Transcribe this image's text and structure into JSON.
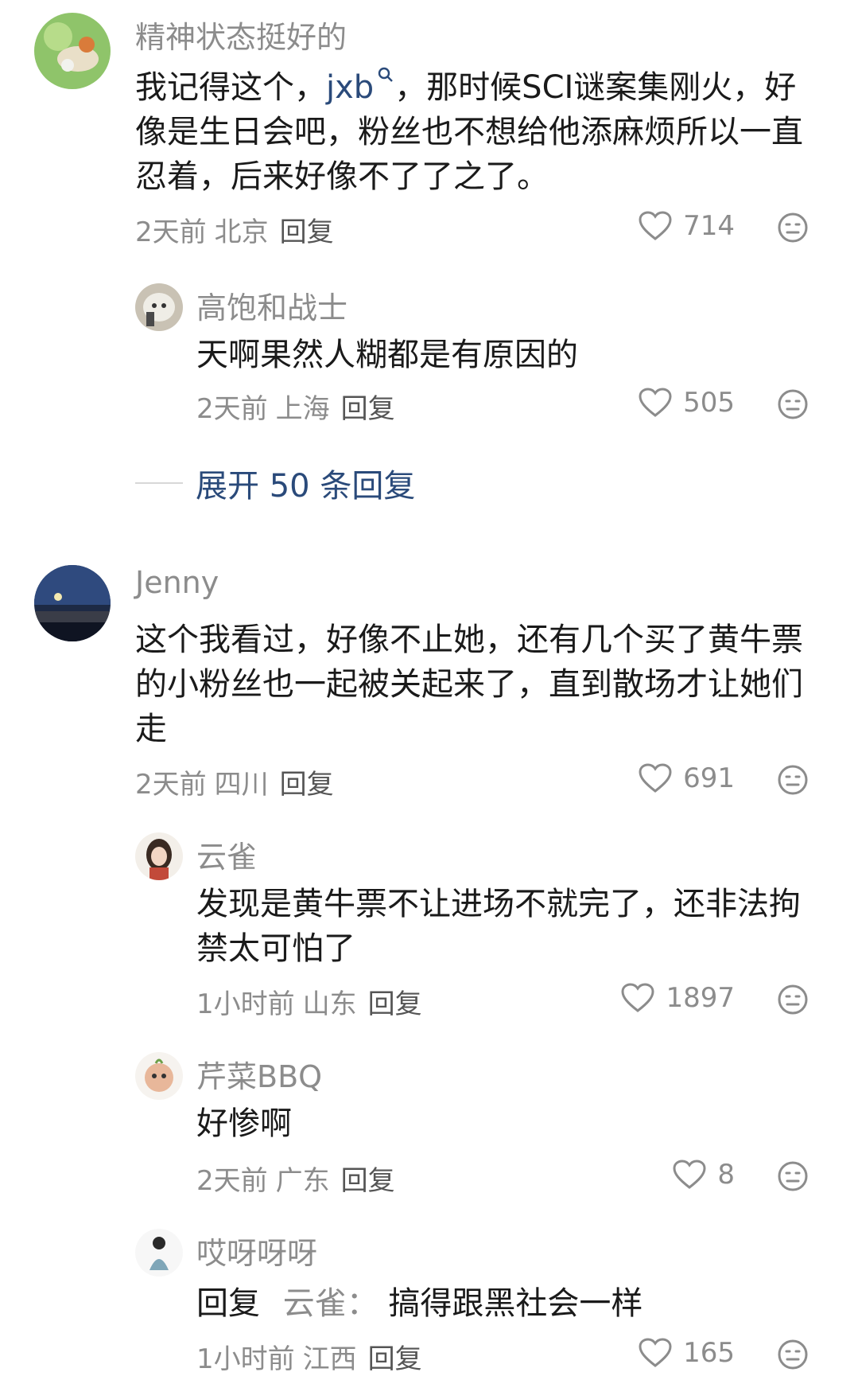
{
  "comments": [
    {
      "username": "精神状态挺好的",
      "text_before": "我记得这个，",
      "mention": "jxb",
      "text_after": "，那时候SCI谜案集刚火，好像是生日会吧，粉丝也不想给他添麻烦所以一直忍着，后来好像不了了之了。",
      "time": "2天前",
      "location": "北京",
      "reply_label": "回复",
      "likes": "714",
      "replies": [
        {
          "username": "高饱和战士",
          "text": "天啊果然人糊都是有原因的",
          "time": "2天前",
          "location": "上海",
          "reply_label": "回复",
          "likes": "505"
        }
      ],
      "expand_label": "展开 50 条回复"
    },
    {
      "username": "Jenny",
      "text": "这个我看过，好像不止她，还有几个买了黄牛票的小粉丝也一起被关起来了，直到散场才让她们走",
      "time": "2天前",
      "location": "四川",
      "reply_label": "回复",
      "likes": "691",
      "replies": [
        {
          "username": "云雀",
          "text": "发现是黄牛票不让进场不就完了，还非法拘禁太可怕了",
          "time": "1小时前",
          "location": "山东",
          "reply_label": "回复",
          "likes": "1897"
        },
        {
          "username": "芹菜BBQ",
          "text": "好惨啊",
          "time": "2天前",
          "location": "广东",
          "reply_label": "回复",
          "likes": "8"
        },
        {
          "username": "哎呀呀呀",
          "reply_prefix": "回复",
          "reply_target": "云雀：",
          "text": "搞得跟黑社会一样",
          "time": "1小时前",
          "location": "江西",
          "reply_label": "回复",
          "likes": "165"
        }
      ]
    }
  ],
  "colors": {
    "meta": "#8c8c8c",
    "link": "#2a4a7a",
    "text": "#1a1a1a"
  },
  "icons": {
    "like": "heart-outline-icon",
    "emoji": "emoji-face-icon"
  }
}
